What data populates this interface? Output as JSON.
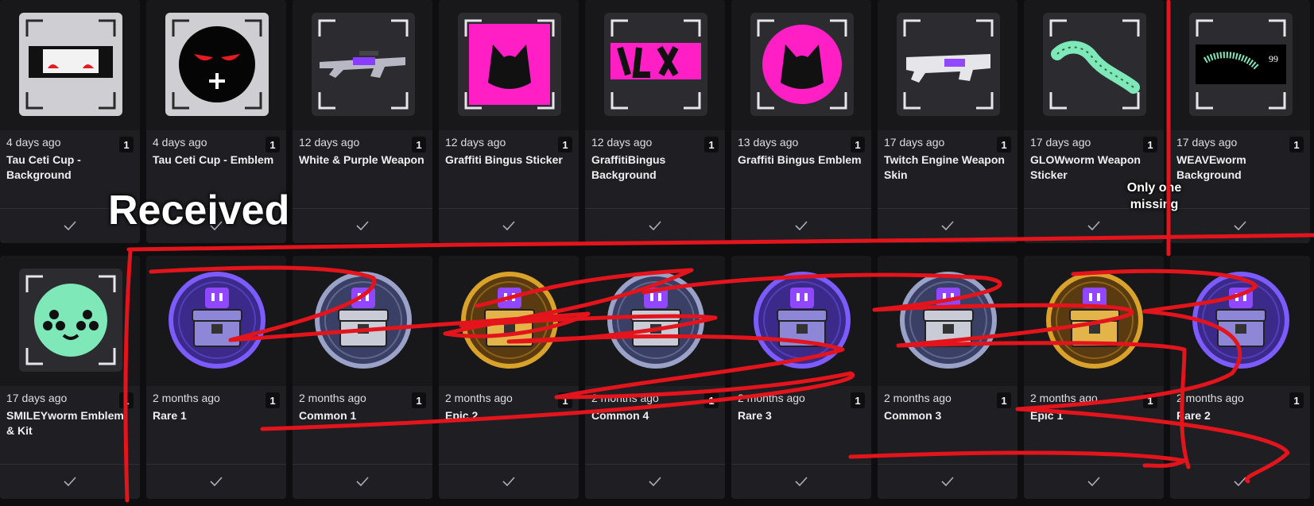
{
  "row1": [
    {
      "date": "4 days ago",
      "name": "Tau Ceti Cup - Background",
      "qty": "1",
      "thumb": "tau-bg"
    },
    {
      "date": "4 days ago",
      "name": "Tau Ceti Cup - Emblem",
      "qty": "1",
      "thumb": "tau-emblem"
    },
    {
      "date": "12 days ago",
      "name": "White & Purple Weapon",
      "qty": "1",
      "thumb": "weapon-rifle"
    },
    {
      "date": "12 days ago",
      "name": "Graffiti Bingus Sticker",
      "qty": "1",
      "thumb": "bingus-sticker"
    },
    {
      "date": "12 days ago",
      "name": "GraffitiBingus Background",
      "qty": "1",
      "thumb": "bingus-bg"
    },
    {
      "date": "13 days ago",
      "name": "Graffiti Bingus Emblem",
      "qty": "1",
      "thumb": "bingus-emblem"
    },
    {
      "date": "17 days ago",
      "name": "Twitch Engine Weapon Skin",
      "qty": "1",
      "thumb": "weapon-engine"
    },
    {
      "date": "17 days ago",
      "name": "GLOWworm Weapon Sticker",
      "qty": "1",
      "thumb": "glowworm"
    },
    {
      "date": "17 days ago",
      "name": "WEAVEworm Background",
      "qty": "1",
      "thumb": "weaveworm",
      "thumb_text": "99"
    }
  ],
  "row2": [
    {
      "date": "17 days ago",
      "name": "SMILEYworm Emblem & Kit",
      "qty": "1",
      "thumb": "smiley"
    },
    {
      "date": "2 months ago",
      "name": "Rare 1",
      "qty": "1",
      "thumb": "chest",
      "tier": "rare"
    },
    {
      "date": "2 months ago",
      "name": "Common 1",
      "qty": "1",
      "thumb": "chest",
      "tier": "common"
    },
    {
      "date": "2 months ago",
      "name": "Epic 2",
      "qty": "1",
      "thumb": "chest",
      "tier": "epic"
    },
    {
      "date": "2 months ago",
      "name": "Common 4",
      "qty": "1",
      "thumb": "chest",
      "tier": "common"
    },
    {
      "date": "2 months ago",
      "name": "Rare 3",
      "qty": "1",
      "thumb": "chest",
      "tier": "rare"
    },
    {
      "date": "2 months ago",
      "name": "Common 3",
      "qty": "1",
      "thumb": "chest",
      "tier": "common"
    },
    {
      "date": "2 months ago",
      "name": "Epic 1",
      "qty": "1",
      "thumb": "chest",
      "tier": "epic"
    },
    {
      "date": "2 months ago",
      "name": "Rare 2",
      "qty": "1",
      "thumb": "chest",
      "tier": "rare"
    }
  ],
  "annotations": {
    "received": "Received",
    "only_one_missing_1": "Only one",
    "only_one_missing_2": "missing"
  },
  "colors": {
    "background": "#0e0e10",
    "card": "#1f1f23",
    "annotation_red": "#e3141b",
    "twitch_purple": "#9147ff",
    "bingus_pink": "#ff1fc4",
    "epic_gold": "#d9a22a",
    "mint": "#7ee8b8"
  }
}
